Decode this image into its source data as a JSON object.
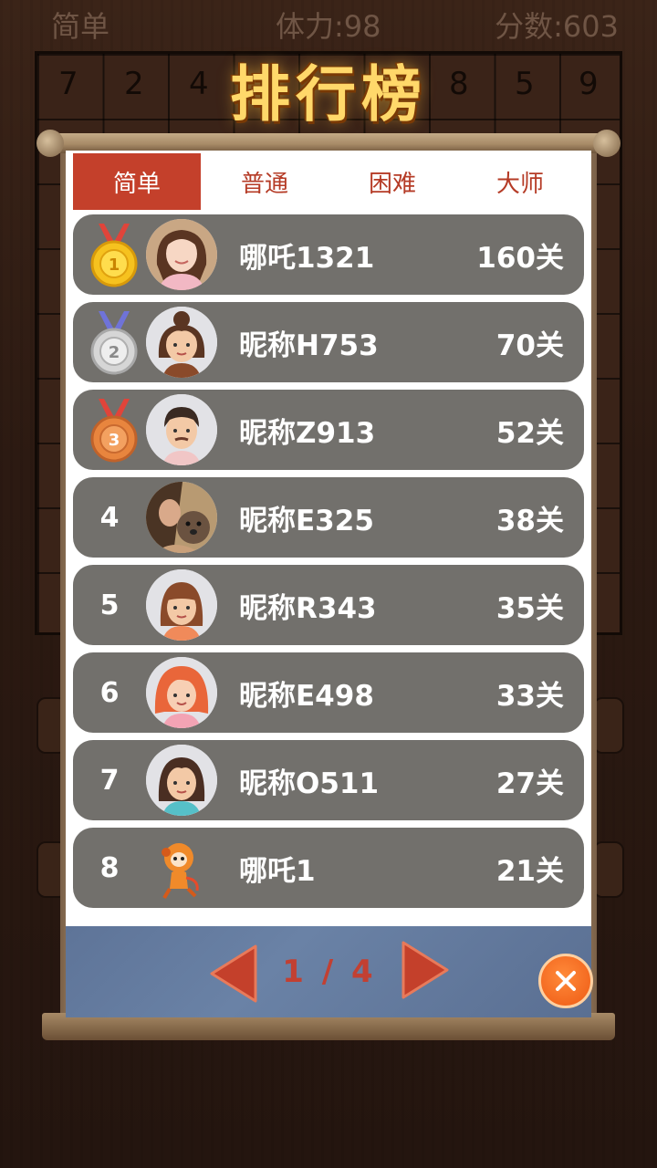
{
  "background": {
    "level": "简单",
    "stamina": "体力:98",
    "score": "分数:603",
    "grid_top_row": [
      "7",
      "2",
      "4",
      "8",
      "5",
      "9"
    ]
  },
  "title": "排行榜",
  "tabs": [
    {
      "label": "简单",
      "active": true
    },
    {
      "label": "普通",
      "active": false
    },
    {
      "label": "困难",
      "active": false
    },
    {
      "label": "大师",
      "active": false
    }
  ],
  "leaderboard": [
    {
      "rank": "1",
      "medal": "gold-medal-icon",
      "avatar": "female-photo-avatar",
      "name": "哪吒1321",
      "score": "160关"
    },
    {
      "rank": "2",
      "medal": "silver-medal-icon",
      "avatar": "female-cartoon-avatar",
      "name": "昵称H753",
      "score": "70关"
    },
    {
      "rank": "3",
      "medal": "bronze-medal-icon",
      "avatar": "male-cartoon-avatar",
      "name": "昵称Z913",
      "score": "52关"
    },
    {
      "rank": "4",
      "medal": "",
      "avatar": "photo-avatar",
      "name": "昵称E325",
      "score": "38关"
    },
    {
      "rank": "5",
      "medal": "",
      "avatar": "female-cartoon-avatar",
      "name": "昵称R343",
      "score": "35关"
    },
    {
      "rank": "6",
      "medal": "",
      "avatar": "redhead-cartoon-avatar",
      "name": "昵称E498",
      "score": "33关"
    },
    {
      "rank": "7",
      "medal": "",
      "avatar": "female-cartoon-avatar",
      "name": "昵称O511",
      "score": "27关"
    },
    {
      "rank": "8",
      "medal": "",
      "avatar": "mascot-avatar",
      "name": "哪吒1",
      "score": "21关"
    }
  ],
  "pagination": {
    "text": "1 / 4",
    "current": 1,
    "total": 4
  },
  "colors": {
    "accent": "#c4402b",
    "row": "#72706c",
    "footer": "#6a82a6",
    "close": "#ee5a14"
  }
}
